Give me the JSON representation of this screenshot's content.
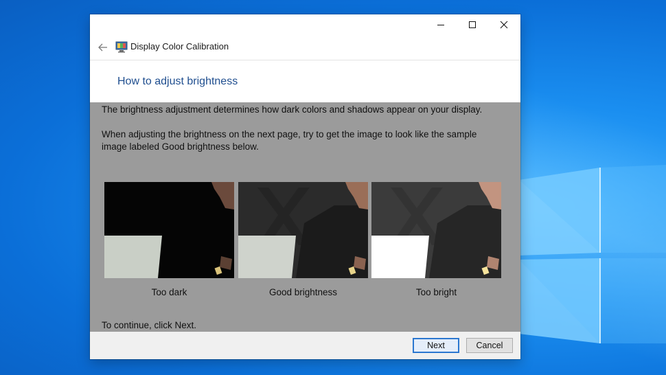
{
  "window": {
    "app_title": "Display Color Calibration",
    "heading": "How to adjust brightness"
  },
  "titlebar": {
    "minimize_icon": "minimize-icon",
    "maximize_icon": "maximize-icon",
    "close_icon": "close-icon"
  },
  "nav": {
    "back_icon": "back-arrow-icon",
    "app_icon": "display-calibration-icon"
  },
  "content": {
    "para1": "The brightness adjustment determines how dark colors and shadows appear on your display.",
    "para2": "When adjusting the brightness on the next page, try to get the image to look like the sample image labeled Good brightness below.",
    "samples": [
      {
        "label": "Too dark"
      },
      {
        "label": "Good brightness"
      },
      {
        "label": "Too bright"
      }
    ],
    "continue_text": "To continue, click Next."
  },
  "footer": {
    "next_label": "Next",
    "cancel_label": "Cancel"
  },
  "colors": {
    "content_bg": "#9b9b9b",
    "heading": "#1f4e8f",
    "desktop_blue": "#0b6fd8",
    "default_button_border": "#2b77d0"
  }
}
